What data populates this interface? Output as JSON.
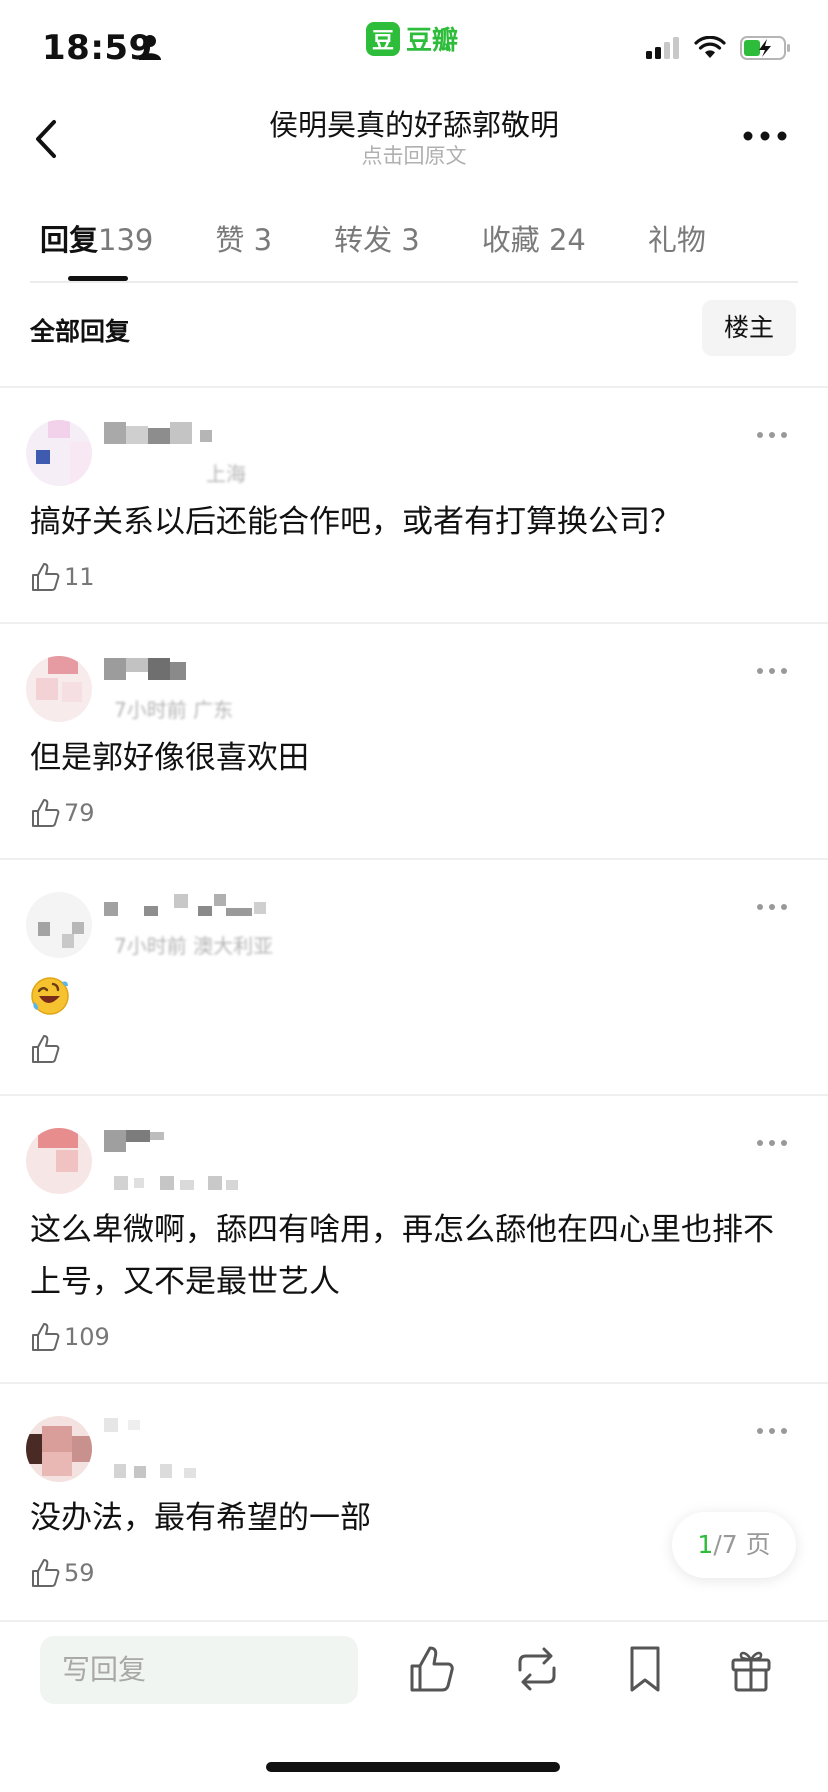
{
  "status": {
    "time": "18:59"
  },
  "app": {
    "name": "豆瓣",
    "logo_char": "豆"
  },
  "nav": {
    "title": "侯明昊真的好舔郭敬明",
    "subtitle": "点击回原文"
  },
  "tabs": [
    {
      "label": "回复",
      "count": "139",
      "active": true
    },
    {
      "label": "赞",
      "count": "3"
    },
    {
      "label": "转发",
      "count": "3"
    },
    {
      "label": "收藏",
      "count": "24"
    },
    {
      "label": "礼物",
      "count": ""
    }
  ],
  "section": {
    "title": "全部回复",
    "op_filter": "楼主"
  },
  "comments": [
    {
      "meta": "上海",
      "text": "搞好关系以后还能合作吧，或者有打算换公司？",
      "likes": "11"
    },
    {
      "meta": "7小时前 广东",
      "text": "但是郭好像很喜欢田",
      "likes": "79"
    },
    {
      "meta": "7小时前 澳大利亚",
      "text": "",
      "emoji": "rolling-on-floor-laughing",
      "likes": ""
    },
    {
      "meta": "",
      "text": "这么卑微啊，舔四有啥用，再怎么舔他在四心里也排不上号，又不是最世艺人",
      "likes": "109"
    },
    {
      "meta": "",
      "text": "没办法，最有希望的一部",
      "likes": "59"
    }
  ],
  "pager": {
    "current": "1",
    "total": "/7 页"
  },
  "bottom": {
    "reply_placeholder": "写回复"
  },
  "colors": {
    "brand": "#2dbd3b",
    "text": "#111111",
    "muted": "#7a7a7a"
  }
}
